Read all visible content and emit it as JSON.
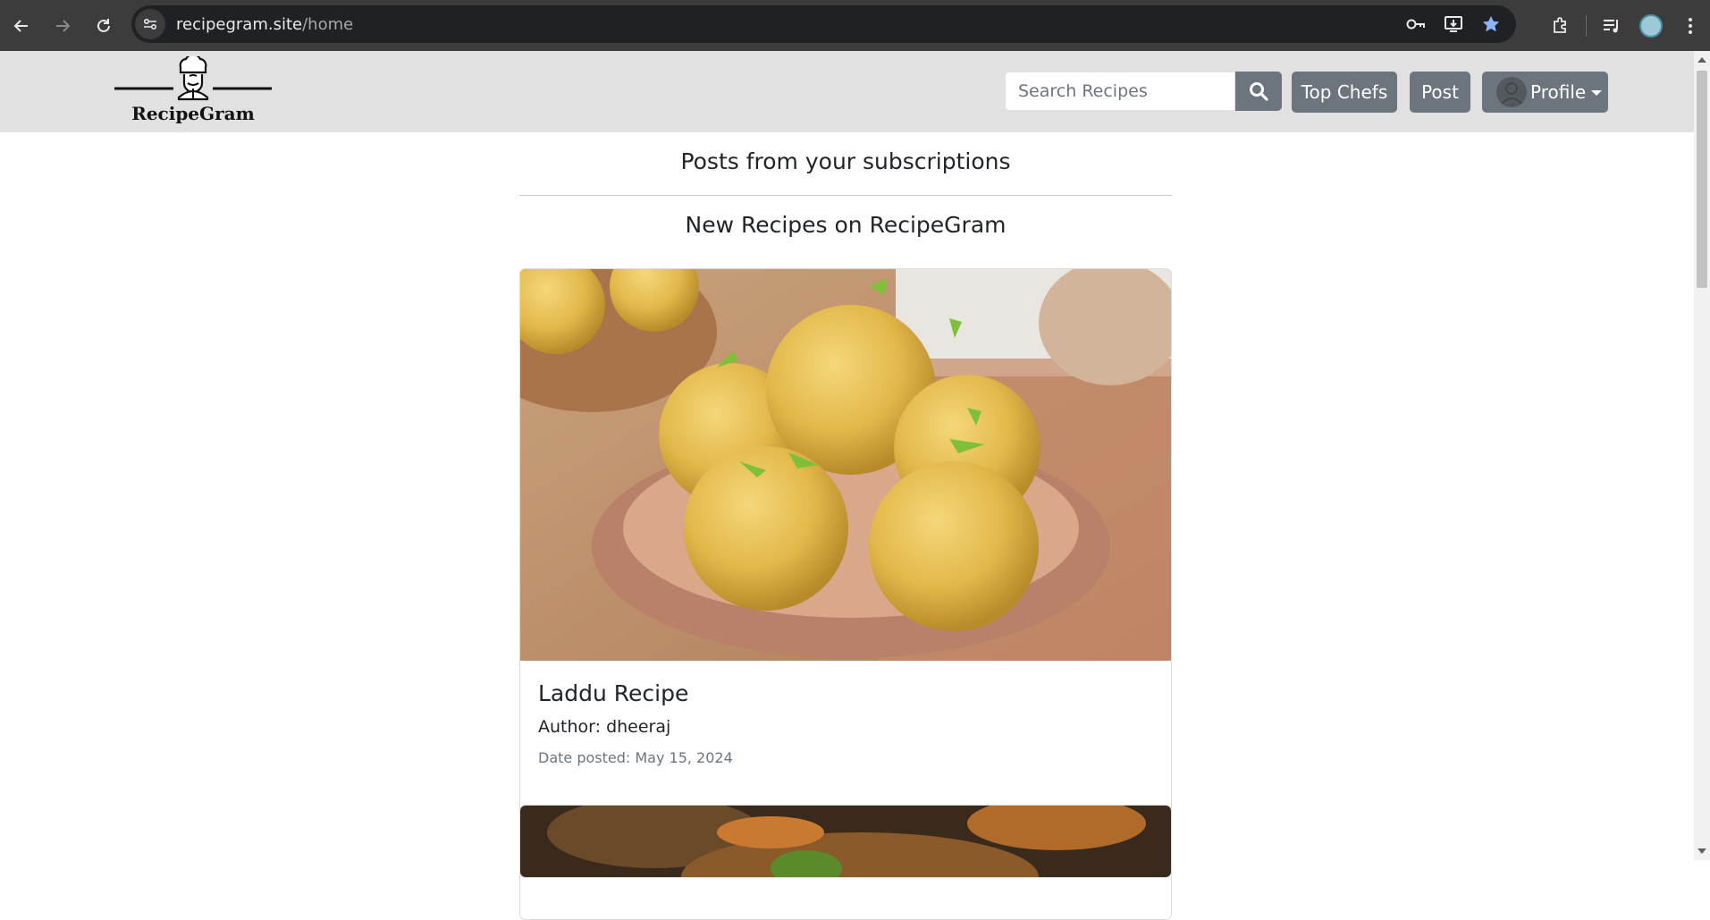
{
  "browser": {
    "url_host": "recipegram.site",
    "url_path": "/home"
  },
  "site": {
    "logo_text": "RecipeGram",
    "search_placeholder": "Search Recipes",
    "nav": {
      "top_chefs": "Top Chefs",
      "post": "Post",
      "profile": "Profile"
    }
  },
  "main": {
    "subscriptions_heading": "Posts from your subscriptions",
    "new_recipes_heading": "New Recipes on RecipeGram",
    "recipes": [
      {
        "title": "Laddu Recipe",
        "author": "Author: dheeraj",
        "date": "Date posted: May 15, 2024"
      }
    ]
  },
  "colors": {
    "header_bg": "#e1e1e1",
    "button_grey": "#6c757d",
    "chrome_bg": "#3c3c3c"
  }
}
